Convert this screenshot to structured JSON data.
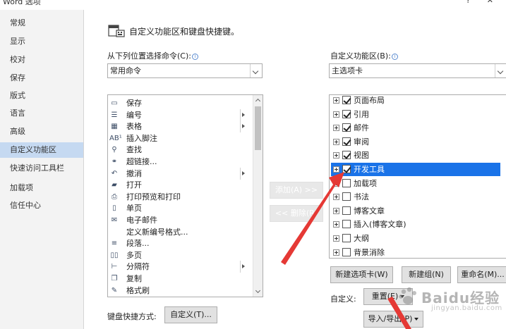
{
  "window": {
    "title": "Word 选项",
    "controls": "? ✕"
  },
  "sidebar": {
    "items": [
      {
        "label": "常规",
        "active": false
      },
      {
        "label": "显示",
        "active": false
      },
      {
        "label": "校对",
        "active": false
      },
      {
        "label": "保存",
        "active": false
      },
      {
        "label": "版式",
        "active": false
      },
      {
        "label": "语言",
        "active": false
      },
      {
        "label": "高级",
        "active": false
      },
      {
        "label": "自定义功能区",
        "active": true
      },
      {
        "label": "快速访问工具栏",
        "active": false
      },
      {
        "label": "加载项",
        "active": false
      },
      {
        "label": "信任中心",
        "active": false
      }
    ]
  },
  "header": {
    "text": "自定义功能区和键盘快捷键。",
    "icon": "ribbon-customize-icon"
  },
  "left_panel": {
    "label": "从下列位置选择命令(C):",
    "info": "i",
    "combo_value": "常用命令",
    "commands": [
      {
        "icon": "save-icon",
        "glyph": "▭",
        "label": "保存",
        "submenu": false
      },
      {
        "icon": "numbering-icon",
        "glyph": "☰",
        "label": "编号",
        "submenu": true
      },
      {
        "icon": "table-icon",
        "glyph": "▦",
        "label": "表格",
        "submenu": true
      },
      {
        "icon": "footnote-icon",
        "glyph": "AB¹",
        "label": "插入脚注",
        "submenu": false
      },
      {
        "icon": "find-icon",
        "glyph": "⚲",
        "label": "查找",
        "submenu": false
      },
      {
        "icon": "hyperlink-icon",
        "glyph": "⚭",
        "label": "超链接...",
        "submenu": false
      },
      {
        "icon": "undo-icon",
        "glyph": "↶",
        "label": "撤消",
        "submenu": true
      },
      {
        "icon": "open-folder-icon",
        "glyph": "▰",
        "label": "打开",
        "submenu": false
      },
      {
        "icon": "print-preview-icon",
        "glyph": "⎙",
        "label": "打印预览和打印",
        "submenu": false
      },
      {
        "icon": "single-page-icon",
        "glyph": "▯",
        "label": "单页",
        "submenu": false
      },
      {
        "icon": "email-icon",
        "glyph": "✉",
        "label": "电子邮件",
        "submenu": false
      },
      {
        "icon": "none",
        "glyph": "",
        "label": "定义新编号格式...",
        "submenu": false
      },
      {
        "icon": "paragraph-icon",
        "glyph": "≡",
        "label": "段落...",
        "submenu": false
      },
      {
        "icon": "multi-page-icon",
        "glyph": "▯▯",
        "label": "多页",
        "submenu": false
      },
      {
        "icon": "break-icon",
        "glyph": "⊢",
        "label": "分隔符",
        "submenu": true
      },
      {
        "icon": "copy-icon",
        "glyph": "❐",
        "label": "复制",
        "submenu": false
      },
      {
        "icon": "format-painter-icon",
        "glyph": "✎",
        "label": "格式刷",
        "submenu": false
      }
    ],
    "shortcut_label": "键盘快捷方式:",
    "customize_button": "自定义(T)..."
  },
  "middle_buttons": {
    "add": "添加(A) >>",
    "remove": "<< 删除(R)"
  },
  "right_panel": {
    "label": "自定义功能区(B):",
    "info": "i",
    "combo_value": "主选项卡",
    "tabs": [
      {
        "label": "页面布局",
        "checked": true,
        "selected": false
      },
      {
        "label": "引用",
        "checked": true,
        "selected": false
      },
      {
        "label": "邮件",
        "checked": true,
        "selected": false
      },
      {
        "label": "审阅",
        "checked": true,
        "selected": false
      },
      {
        "label": "视图",
        "checked": true,
        "selected": false
      },
      {
        "label": "开发工具",
        "checked": true,
        "selected": true
      },
      {
        "label": "加载项",
        "checked": false,
        "selected": false
      },
      {
        "label": "书法",
        "checked": false,
        "selected": false
      },
      {
        "label": "博客文章",
        "checked": false,
        "selected": false
      },
      {
        "label": "插入(博客文章)",
        "checked": false,
        "selected": false
      },
      {
        "label": "大纲",
        "checked": false,
        "selected": false
      },
      {
        "label": "背景消除",
        "checked": false,
        "selected": false
      }
    ],
    "new_tab_button": "新建选项卡(W)",
    "new_group_button": "新建组(N)",
    "rename_button": "重命名(M)...",
    "customize_label": "自定义:",
    "reset_button": "重置(E)",
    "import_export_button": "导入/导出(P)"
  },
  "watermark": {
    "text": "Baidu经验",
    "sub": "jingyan.baidu.com"
  },
  "colors": {
    "selection": "#1a73e8",
    "sidebar_active": "#c5d9f1",
    "annotation_arrow": "#e53935"
  }
}
